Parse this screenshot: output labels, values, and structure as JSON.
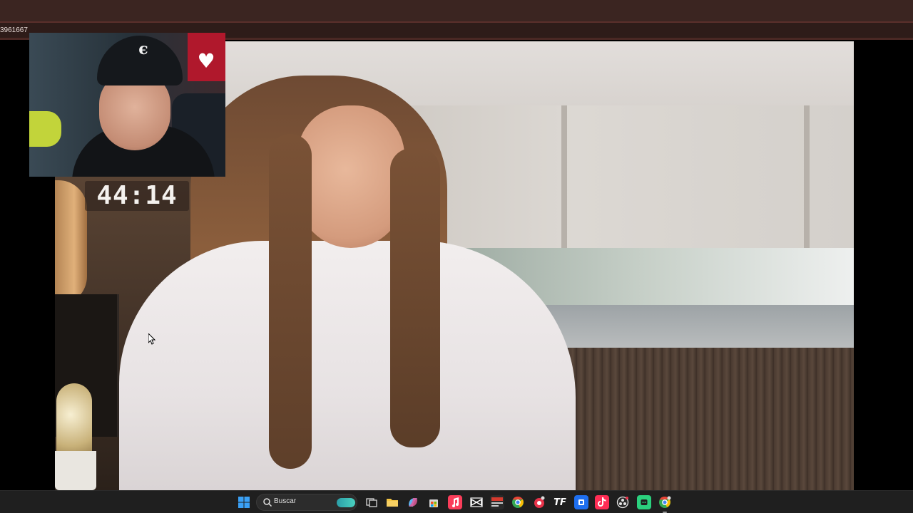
{
  "browser": {
    "url_fragment": "3961667"
  },
  "video": {
    "timer": "44:14"
  },
  "taskbar": {
    "search_placeholder": "Buscar",
    "icons": [
      {
        "name": "windows-start",
        "color": "#3aa0f5"
      },
      {
        "name": "task-view",
        "color": "#d8d8d8"
      },
      {
        "name": "file-explorer",
        "color": "#f4c542"
      },
      {
        "name": "copilot",
        "color": "#5fb4f0"
      },
      {
        "name": "microsoft-store",
        "color": "#ffffff"
      },
      {
        "name": "apple-music",
        "color": "#fa3d5a"
      },
      {
        "name": "capcut",
        "color": "#ffffff"
      },
      {
        "name": "news-app",
        "color": "#d63a2e"
      },
      {
        "name": "chrome",
        "color": "#34a853"
      },
      {
        "name": "recorder",
        "color": "#e8334a"
      },
      {
        "name": "tf-app",
        "color": "#ffffff"
      },
      {
        "name": "app-blue",
        "color": "#1e6ff0"
      },
      {
        "name": "tiktok",
        "color": "#ff2d55"
      },
      {
        "name": "obs",
        "color": "#e6e6e6"
      },
      {
        "name": "app-green",
        "color": "#2bd17e"
      },
      {
        "name": "chrome-profile",
        "color": "#34a853"
      }
    ]
  }
}
